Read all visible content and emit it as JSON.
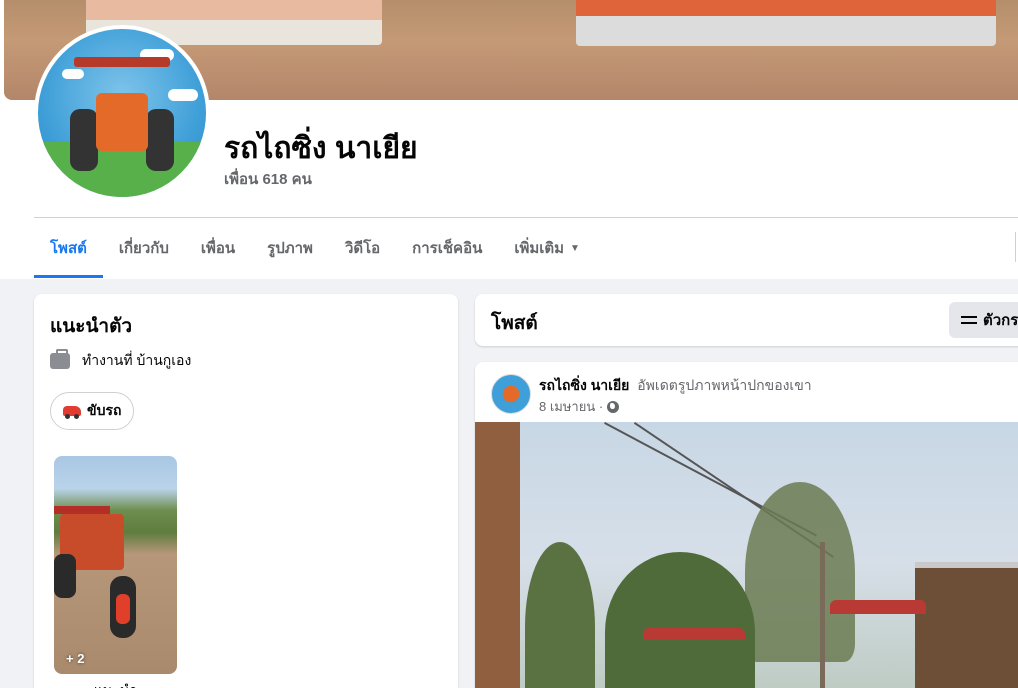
{
  "profile": {
    "name": "รถไถซิ่ง นาเยีย",
    "friends": "เพื่อน 618 คน"
  },
  "tabs": [
    {
      "label": "โพสต์",
      "active": true
    },
    {
      "label": "เกี่ยวกับ",
      "active": false
    },
    {
      "label": "เพื่อน",
      "active": false
    },
    {
      "label": "รูปภาพ",
      "active": false
    },
    {
      "label": "วิดีโอ",
      "active": false
    },
    {
      "label": "การเช็คอิน",
      "active": false
    },
    {
      "label": "เพิ่มเติม",
      "active": false,
      "icon": "caret-down-icon"
    }
  ],
  "intro": {
    "title": "แนะนำตัว",
    "work": "ทำงานที่ บ้านกูเอง",
    "work_icon": "briefcase-icon",
    "hobby": "ขับรถ",
    "hobby_icon": "car-icon",
    "featured_count": "+ 2",
    "featured_label": "แนะนำ"
  },
  "posts_header": {
    "title": "โพสต์",
    "filter_label": "ตัวกร"
  },
  "post": {
    "author": "รถไถซิ่ง นาเยีย",
    "action": "อัพเดตรูปภาพหน้าปกของเขา",
    "date": "8 เมษายน ·",
    "privacy_icon": "globe-icon"
  },
  "colors": {
    "accent": "#1877f2",
    "page_bg": "#f0f2f5",
    "secondary_text": "#65676b"
  }
}
